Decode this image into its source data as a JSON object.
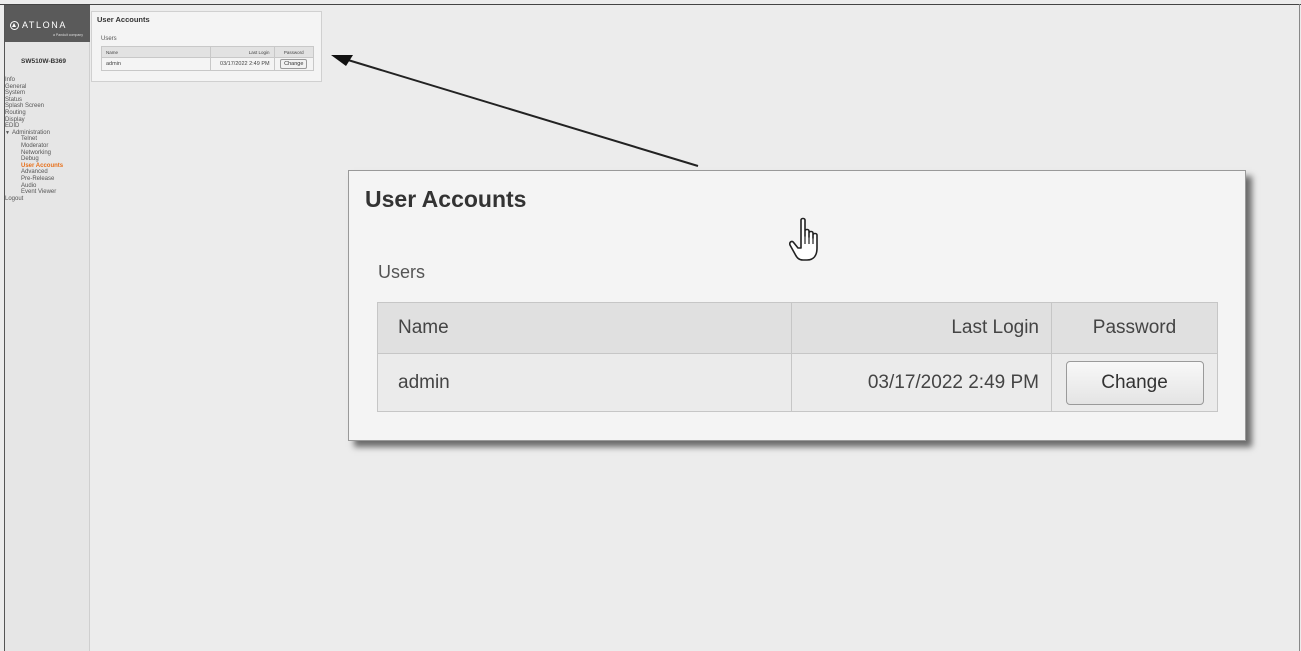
{
  "brand": {
    "logo_text": "ATLONA",
    "logo_sub": "a Panduit company",
    "device_name": "SW510W-B369"
  },
  "sidebar": {
    "items": [
      {
        "label": "Info",
        "level": 0
      },
      {
        "label": "General",
        "level": 0
      },
      {
        "label": "System",
        "level": 0
      },
      {
        "label": "Status",
        "level": 0
      },
      {
        "label": "Splash Screen",
        "level": 0
      },
      {
        "label": "Routing",
        "level": 0
      },
      {
        "label": "Display",
        "level": 0
      },
      {
        "label": "EDID",
        "level": 0
      },
      {
        "label": "Administration",
        "level": 0
      },
      {
        "label": "Telnet",
        "level": 1
      },
      {
        "label": "Moderator",
        "level": 1
      },
      {
        "label": "Networking",
        "level": 1
      },
      {
        "label": "Debug",
        "level": 1
      },
      {
        "label": "User Accounts",
        "level": 1,
        "active": true
      },
      {
        "label": "Advanced",
        "level": 1
      },
      {
        "label": "Pre-Release",
        "level": 1
      },
      {
        "label": "Audio",
        "level": 1
      },
      {
        "label": "Event Viewer",
        "level": 1
      },
      {
        "label": "Logout",
        "level": 0
      }
    ]
  },
  "panel": {
    "title": "User Accounts",
    "section": "Users",
    "columns": [
      "Name",
      "Last Login",
      "Password"
    ],
    "rows": [
      {
        "name": "admin",
        "last_login": "03/17/2022 2:49 PM",
        "action": "Change"
      }
    ]
  },
  "colors": {
    "accent": "#e8701a",
    "logo_bg": "#5a5a5a",
    "background": "#ececec"
  }
}
